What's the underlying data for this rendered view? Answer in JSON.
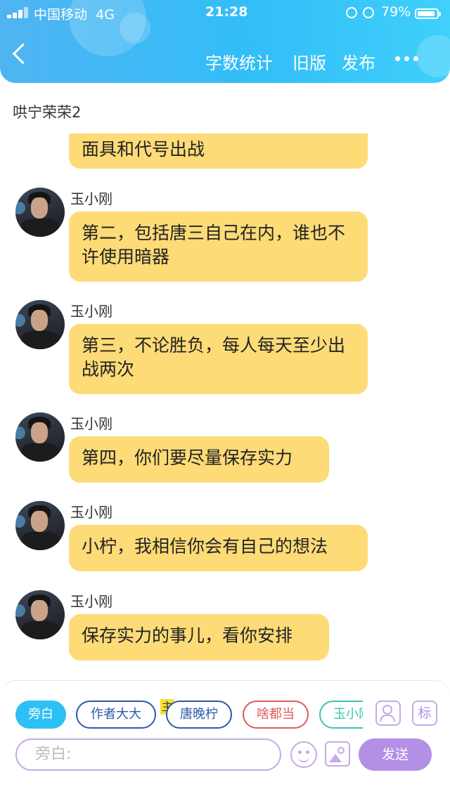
{
  "status": {
    "carrier": "中国移动",
    "network": "4G",
    "time": "21:28",
    "battery": "79%",
    "battery_level": 0.79
  },
  "nav": {
    "stats_label": "字数统计",
    "old_label": "旧版",
    "publish_label": "发布"
  },
  "title": "哄宁荣荣2",
  "messages": [
    {
      "sender": "",
      "text": "面具和代号出战"
    },
    {
      "sender": "玉小刚",
      "text": "第二，包括唐三自己在内，谁也不许使用暗器"
    },
    {
      "sender": "玉小刚",
      "text": "第三，不论胜负，每人每天至少出战两次"
    },
    {
      "sender": "玉小刚",
      "text": "第四，你们要尽量保存实力"
    },
    {
      "sender": "玉小刚",
      "text": "小柠，我相信你会有自己的想法"
    },
    {
      "sender": "玉小刚",
      "text": "保存实力的事儿，看你安排"
    }
  ],
  "composer": {
    "roles": [
      "旁白",
      "作者大大",
      "唐晚柠",
      "啥都当",
      "玉小刚"
    ],
    "main_badge": "主",
    "tag_button": "标",
    "input_placeholder": "旁白:",
    "send_label": "发送"
  },
  "colors": {
    "bubble": "#fddb77",
    "header": "#39b6f5",
    "accent": "#b48fe6"
  }
}
